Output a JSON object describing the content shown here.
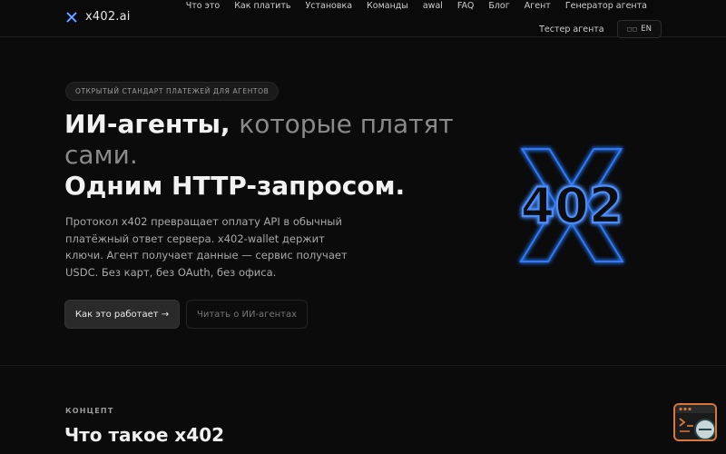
{
  "brand": {
    "name": "x402.ai"
  },
  "nav": {
    "row1": [
      "Что это",
      "Как платить",
      "Установка",
      "Команды",
      "awal",
      "FAQ",
      "Блог",
      "Агент",
      "Генератор агента"
    ],
    "tester": "Тестер агента",
    "lang": "EN"
  },
  "hero": {
    "badge": "ОТКРЫТЫЙ СТАНДАРТ ПЛАТЕЖЕЙ ДЛЯ АГЕНТОВ",
    "title_strong": "ИИ-агенты,",
    "title_dim": "которые платят сами.",
    "title_line2": "Одним HTTP-запросом.",
    "description": "Протокол x402 превращает оплату API в обычный платёжный ответ сервера. x402-wallet держит ключи. Агент получает данные — сервис получает USDC. Без карт, без OAuth, без офиса.",
    "cta_primary": "Как это работает →",
    "cta_secondary": "Читать о ИИ-агентах",
    "visual": {
      "letter": "X",
      "number": "402"
    }
  },
  "section": {
    "label": "КОНЦЕПТ",
    "title": "Что такое x402"
  },
  "colors": {
    "background": "#0b0b0b",
    "neon": "#2f7bff",
    "widget_border": "#d9773a"
  }
}
